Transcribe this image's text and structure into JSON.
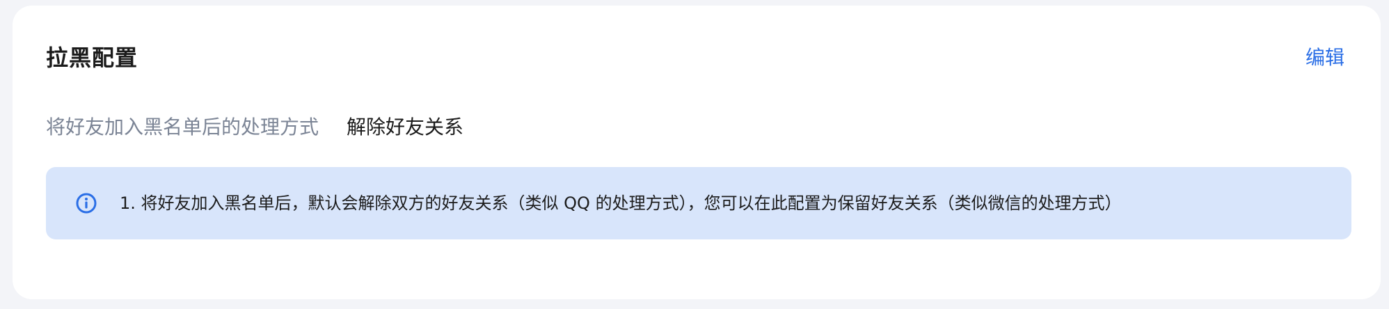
{
  "card": {
    "title": "拉黑配置",
    "edit_label": "编辑"
  },
  "field": {
    "label": "将好友加入黑名单后的处理方式",
    "value": "解除好友关系"
  },
  "notice": {
    "icon": "info-icon",
    "text": "1. 将好友加入黑名单后，默认会解除双方的好友关系（类似 QQ 的处理方式），您可以在此配置为保留好友关系（类似微信的处理方式）"
  },
  "colors": {
    "accent": "#2a6ee6",
    "notice_background": "#d8e5fb",
    "label": "#7b8495",
    "text": "#1b1b1b",
    "page_background": "#f3f4f8"
  }
}
